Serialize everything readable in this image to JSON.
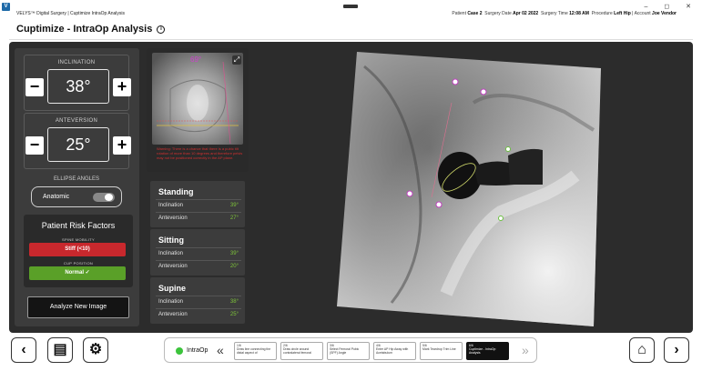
{
  "titlebar": {
    "app_icon": "V",
    "app_title": "VELYS™ Digital Surgery  |  Cuptimize IntraOp Analysis",
    "meta": [
      {
        "label": "Patient",
        "value": "Case 2"
      },
      {
        "label": "Surgery Date",
        "value": "Apr 02 2022"
      },
      {
        "label": "Surgery Time",
        "value": "12:08 AM"
      },
      {
        "label": "Procedure",
        "value": "Left Hip"
      },
      {
        "label": "Account",
        "value": "Joe Vendor"
      }
    ],
    "window_controls": "–  ◻  ✕"
  },
  "header": {
    "title": "Cuptimize - IntraOp Analysis",
    "info_icon": "i"
  },
  "controls": {
    "inclination": {
      "label": "INCLINATION",
      "value": "38°",
      "minus": "−",
      "plus": "+"
    },
    "anteversion": {
      "label": "ANTEVERSION",
      "value": "25°",
      "minus": "−",
      "plus": "+"
    },
    "ellipse": {
      "label": "ELLIPSE ANGLES",
      "toggle_label": "Anatomic",
      "toggle_on": false
    },
    "risk": {
      "title": "Patient Risk Factors",
      "spine_label": "SPINE MOBILITY",
      "spine_value": "Stiff (<10)",
      "spine_color": "#c8282d",
      "cup_label": "CUP POSITION",
      "cup_value": "Normal ✓",
      "cup_color": "#5aa028"
    },
    "analyze_button": "Analyze New Image"
  },
  "thumbnail": {
    "angle": "69°",
    "expand_icon": "⤢",
    "warning": "Warning: There is a chance that there is a pubic tilt rotation of more than 10 degrees and therefore pelvis may not be positioned correctly in the AP plane."
  },
  "positions": [
    {
      "title": "Standing",
      "inclination_label": "Inclination",
      "inclination": "39°",
      "anteversion_label": "Anteversion",
      "anteversion": "27°"
    },
    {
      "title": "Sitting",
      "inclination_label": "Inclination",
      "inclination": "39°",
      "anteversion_label": "Anteversion",
      "anteversion": "20°"
    },
    {
      "title": "Supine",
      "inclination_label": "Inclination",
      "inclination": "38°",
      "anteversion_label": "Anteversion",
      "anteversion": "25°"
    }
  ],
  "bottombar": {
    "back_icon": "‹",
    "chat_icon": "▤",
    "settings_icon": "⚙",
    "home_icon": "⌂",
    "forward_icon": "›",
    "status": "IntraOp",
    "prev_icon": "«",
    "next_icon": "»",
    "steps": [
      {
        "num": "1/6",
        "text": "Draw line connecting the distal aspect of"
      },
      {
        "num": "2/6",
        "text": "Draw circle around contralateral femoral"
      },
      {
        "num": "3/6",
        "text": "Select Femoral Pubic (SPF) Angle"
      },
      {
        "num": "4/6",
        "text": "Enter AP Hip Away with Acetabulum"
      },
      {
        "num": "5/6",
        "text": "Mark Teardrop Trim Line"
      },
      {
        "num": "6/6",
        "text": "Cuptimize - IntraOp Analysis"
      }
    ]
  }
}
